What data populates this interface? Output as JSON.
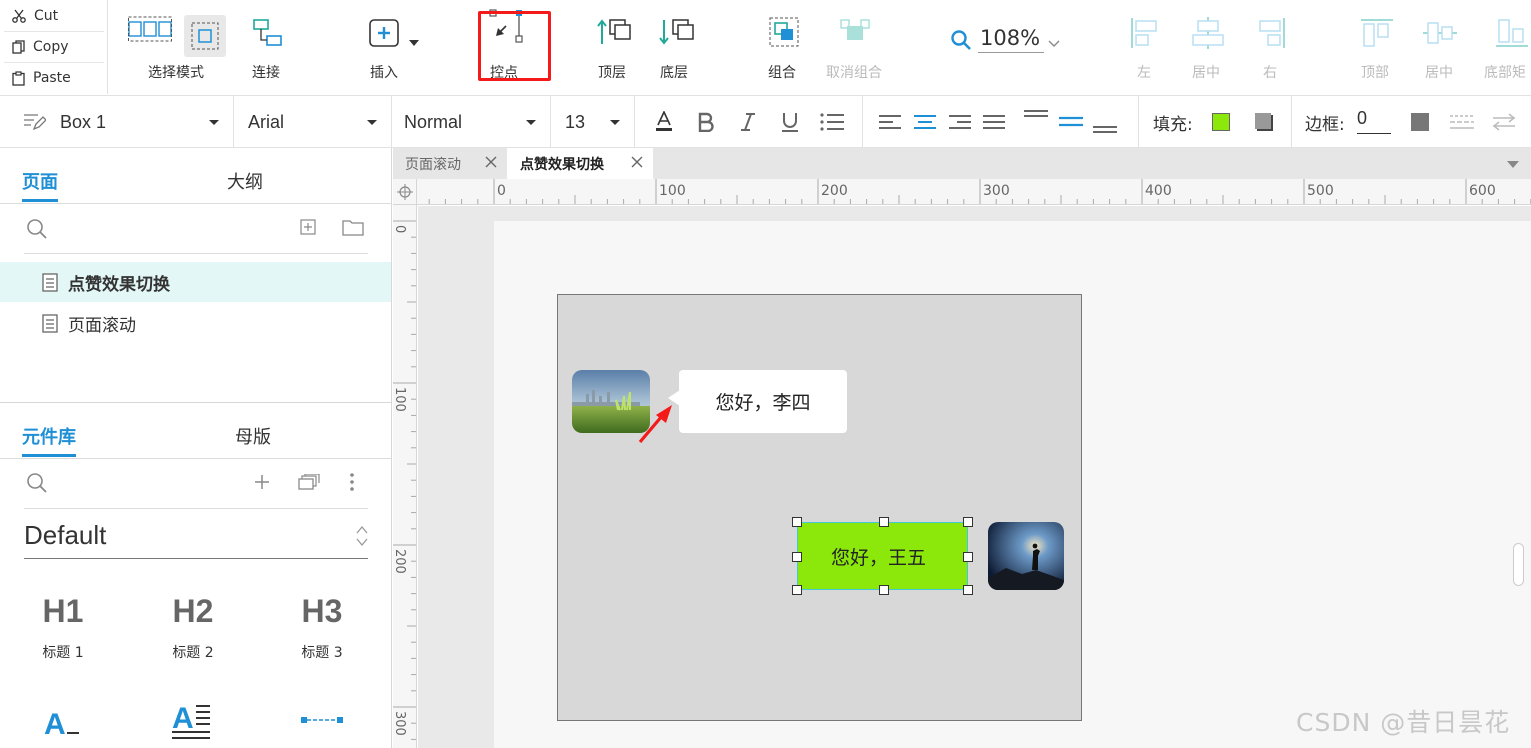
{
  "clipboard": {
    "cut": "Cut",
    "copy": "Copy",
    "paste": "Paste"
  },
  "toolbar": {
    "select_mode": "选择模式",
    "connect": "连接",
    "insert": "插入",
    "control_point": "控点",
    "top_layer": "顶层",
    "bottom_layer": "底层",
    "group": "组合",
    "ungroup": "取消组合",
    "zoom": "108%",
    "align_left": "左",
    "align_center": "居中",
    "align_right": "右",
    "align_top": "顶部",
    "align_middle": "居中",
    "align_bottom": "底部矩"
  },
  "format": {
    "element": "Box 1",
    "font": "Arial",
    "weight": "Normal",
    "size": "13",
    "fill_label": "填充:",
    "fill_color": "#8ce80a",
    "border_label": "边框:",
    "border_value": "0"
  },
  "pages_panel": {
    "tabs": [
      "页面",
      "大纲"
    ],
    "pages": [
      {
        "label": "点赞效果切换",
        "selected": true
      },
      {
        "label": "页面滚动",
        "selected": false
      }
    ]
  },
  "library_panel": {
    "tabs": [
      "元件库",
      "母版"
    ],
    "library": "Default",
    "widgets": [
      {
        "glyph": "H1",
        "label": "标题 1"
      },
      {
        "glyph": "H2",
        "label": "标题 2"
      },
      {
        "glyph": "H3",
        "label": "标题 3"
      }
    ]
  },
  "doc_tabs": [
    "页面滚动",
    "点赞效果切换"
  ],
  "ruler": {
    "top_ticks": [
      "0",
      "100",
      "200",
      "300",
      "400",
      "500",
      "600"
    ],
    "left_ticks": [
      "0",
      "100",
      "200",
      "300"
    ]
  },
  "canvas": {
    "bubble_left_text": "您好，李四",
    "bubble_right_text": "您好，王五"
  },
  "watermark": "CSDN @昔日昙花",
  "colors": {
    "accent": "#1f8fd6",
    "highlight": "#f51a1a",
    "selection": "#41c9d6",
    "green_box": "#8ce80a",
    "teal_icon": "#21a99a"
  }
}
